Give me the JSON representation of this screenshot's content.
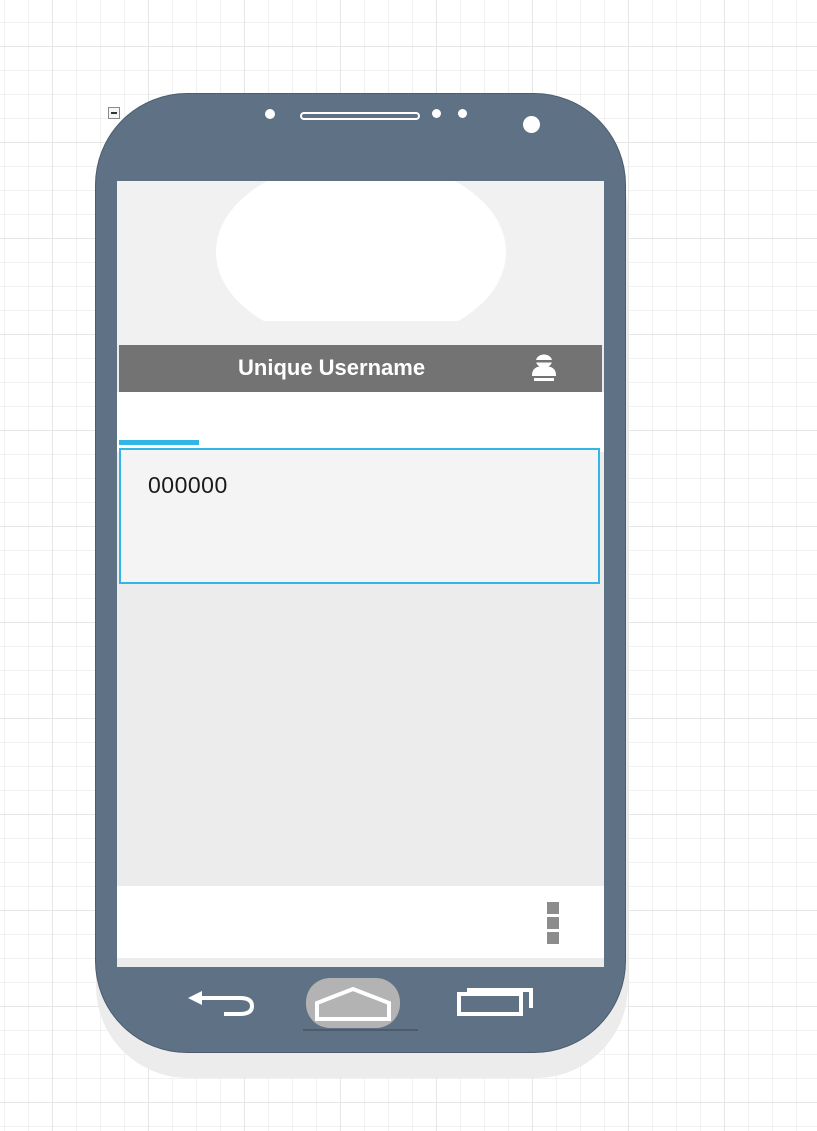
{
  "screen": {
    "title": "Unique Username",
    "code_value": "000000"
  },
  "icons": {
    "collapse": "collapse-icon",
    "user": "user-icon",
    "overflow": "overflow-menu-icon",
    "back": "back-icon",
    "home": "home-icon",
    "recent_apps": "recent-apps-icon"
  },
  "colors": {
    "phone_body": "#5f7184",
    "title_bar": "#737373",
    "accent": "#33b5e5",
    "screen_bg": "#ececec"
  }
}
